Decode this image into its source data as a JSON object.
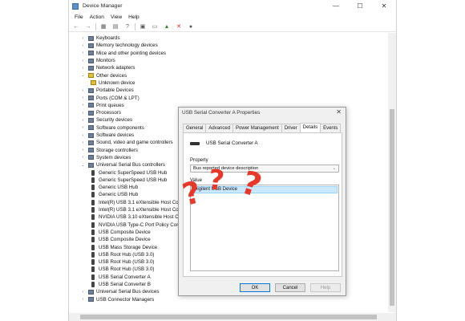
{
  "window": {
    "title": "Device Manager",
    "controls": [
      "—",
      "☐",
      "✕"
    ]
  },
  "menu": [
    "File",
    "Action",
    "View",
    "Help"
  ],
  "toolbar": [
    {
      "name": "back-icon",
      "glyph": "←"
    },
    {
      "name": "forward-icon",
      "glyph": "→"
    },
    {
      "name": "properties-icon",
      "glyph": "▦"
    },
    {
      "name": "document-icon",
      "glyph": "▤"
    },
    {
      "name": "help-icon",
      "glyph": "?"
    },
    {
      "name": "device-icon",
      "glyph": "▣"
    },
    {
      "name": "monitor-icon",
      "glyph": "▭"
    },
    {
      "name": "update-driver-icon",
      "glyph": "▲"
    },
    {
      "name": "uninstall-icon",
      "glyph": "✕"
    },
    {
      "name": "scan-icon",
      "glyph": "●"
    }
  ],
  "tree": [
    {
      "label": "Keyboards",
      "level": 0,
      "expanded": false,
      "icon": "dev"
    },
    {
      "label": "Memory technology devices",
      "level": 0,
      "expanded": false,
      "icon": "dev"
    },
    {
      "label": "Mice and other pointing devices",
      "level": 0,
      "expanded": false,
      "icon": "dev"
    },
    {
      "label": "Monitors",
      "level": 0,
      "expanded": false,
      "icon": "dev"
    },
    {
      "label": "Network adapters",
      "level": 0,
      "expanded": false,
      "icon": "dev"
    },
    {
      "label": "Other devices",
      "level": 0,
      "expanded": true,
      "icon": "warn"
    },
    {
      "label": "Unknown device",
      "level": 1,
      "icon": "warn"
    },
    {
      "label": "Portable Devices",
      "level": 0,
      "expanded": false,
      "icon": "dev"
    },
    {
      "label": "Ports (COM & LPT)",
      "level": 0,
      "expanded": false,
      "icon": "dev"
    },
    {
      "label": "Print queues",
      "level": 0,
      "expanded": false,
      "icon": "dev"
    },
    {
      "label": "Processors",
      "level": 0,
      "expanded": false,
      "icon": "dev"
    },
    {
      "label": "Security devices",
      "level": 0,
      "expanded": false,
      "icon": "dev"
    },
    {
      "label": "Software components",
      "level": 0,
      "expanded": false,
      "icon": "dev"
    },
    {
      "label": "Software devices",
      "level": 0,
      "expanded": false,
      "icon": "dev"
    },
    {
      "label": "Sound, video and game controllers",
      "level": 0,
      "expanded": false,
      "icon": "dev"
    },
    {
      "label": "Storage controllers",
      "level": 0,
      "expanded": false,
      "icon": "dev"
    },
    {
      "label": "System devices",
      "level": 0,
      "expanded": false,
      "icon": "dev"
    },
    {
      "label": "Universal Serial Bus controllers",
      "level": 0,
      "expanded": true,
      "icon": "dev"
    },
    {
      "label": "Generic SuperSpeed USB Hub",
      "level": 1,
      "icon": "usb"
    },
    {
      "label": "Generic SuperSpeed USB Hub",
      "level": 1,
      "icon": "usb"
    },
    {
      "label": "Generic USB Hub",
      "level": 1,
      "icon": "usb"
    },
    {
      "label": "Generic USB Hub",
      "level": 1,
      "icon": "usb"
    },
    {
      "label": "Intel(R) USB 3.1 eXtensible Host Controller",
      "level": 1,
      "icon": "usb"
    },
    {
      "label": "Intel(R) USB 3.1 eXtensible Host Controller",
      "level": 1,
      "icon": "usb"
    },
    {
      "label": "NVIDIA USB 3.10 eXtensible Host Controller",
      "level": 1,
      "icon": "usb"
    },
    {
      "label": "NVIDIA USB Type-C Port Policy Controller",
      "level": 1,
      "icon": "usb"
    },
    {
      "label": "USB Composite Device",
      "level": 1,
      "icon": "usb"
    },
    {
      "label": "USB Composite Device",
      "level": 1,
      "icon": "usb"
    },
    {
      "label": "USB Mass Storage Device",
      "level": 1,
      "icon": "usb"
    },
    {
      "label": "USB Root Hub (USB 3.0)",
      "level": 1,
      "icon": "usb"
    },
    {
      "label": "USB Root Hub (USB 3.0)",
      "level": 1,
      "icon": "usb"
    },
    {
      "label": "USB Root Hub (USB 3.0)",
      "level": 1,
      "icon": "usb"
    },
    {
      "label": "USB Serial Converter A",
      "level": 1,
      "icon": "usb"
    },
    {
      "label": "USB Serial Converter B",
      "level": 1,
      "icon": "usb"
    },
    {
      "label": "Universal Serial Bus devices",
      "level": 0,
      "expanded": false,
      "icon": "dev"
    },
    {
      "label": "USB Connector Managers",
      "level": 0,
      "expanded": false,
      "icon": "dev"
    }
  ],
  "dialog": {
    "title": "USB Serial Converter A Properties",
    "close": "✕",
    "tabs": [
      "General",
      "Advanced",
      "Power Management",
      "Driver",
      "Details",
      "Events"
    ],
    "active_tab": "Details",
    "device_name": "USB Serial Converter A",
    "property_label": "Property",
    "property_value": "Bus reported device description",
    "value_label": "Value",
    "value_item": "Digilent USB Device",
    "buttons": {
      "ok": "OK",
      "cancel": "Cancel",
      "help": "Help"
    }
  },
  "annotations": [
    "?",
    "?",
    "?"
  ],
  "colors": {
    "annotation": "#e33a2c",
    "selection": "#cce8ff"
  }
}
